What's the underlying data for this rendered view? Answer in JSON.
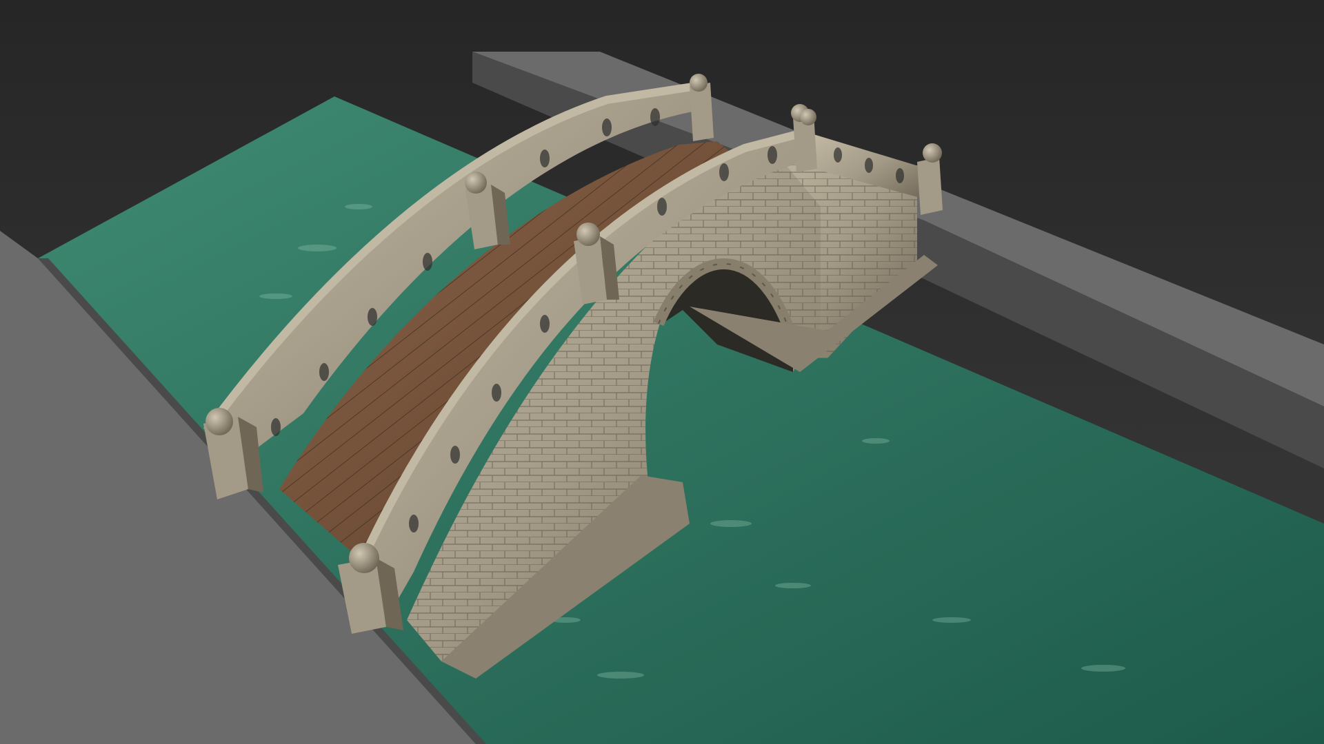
{
  "scene": {
    "subject": "stone-arch-bridge",
    "colors": {
      "background_top": "#262626",
      "background_bottom": "#3c3c3c",
      "ground": "#6b6b6b",
      "ground_shadow": "#4a4a4a",
      "water_light": "#3f8a72",
      "water_dark": "#1d5a4a",
      "stone": "#a39a87",
      "stone_dark": "#6f6656",
      "stone_light": "#c2b9a4",
      "wood": "#8b6448",
      "wood_dark": "#5c3f2c",
      "arch_shadow": "#2b2a25"
    }
  }
}
